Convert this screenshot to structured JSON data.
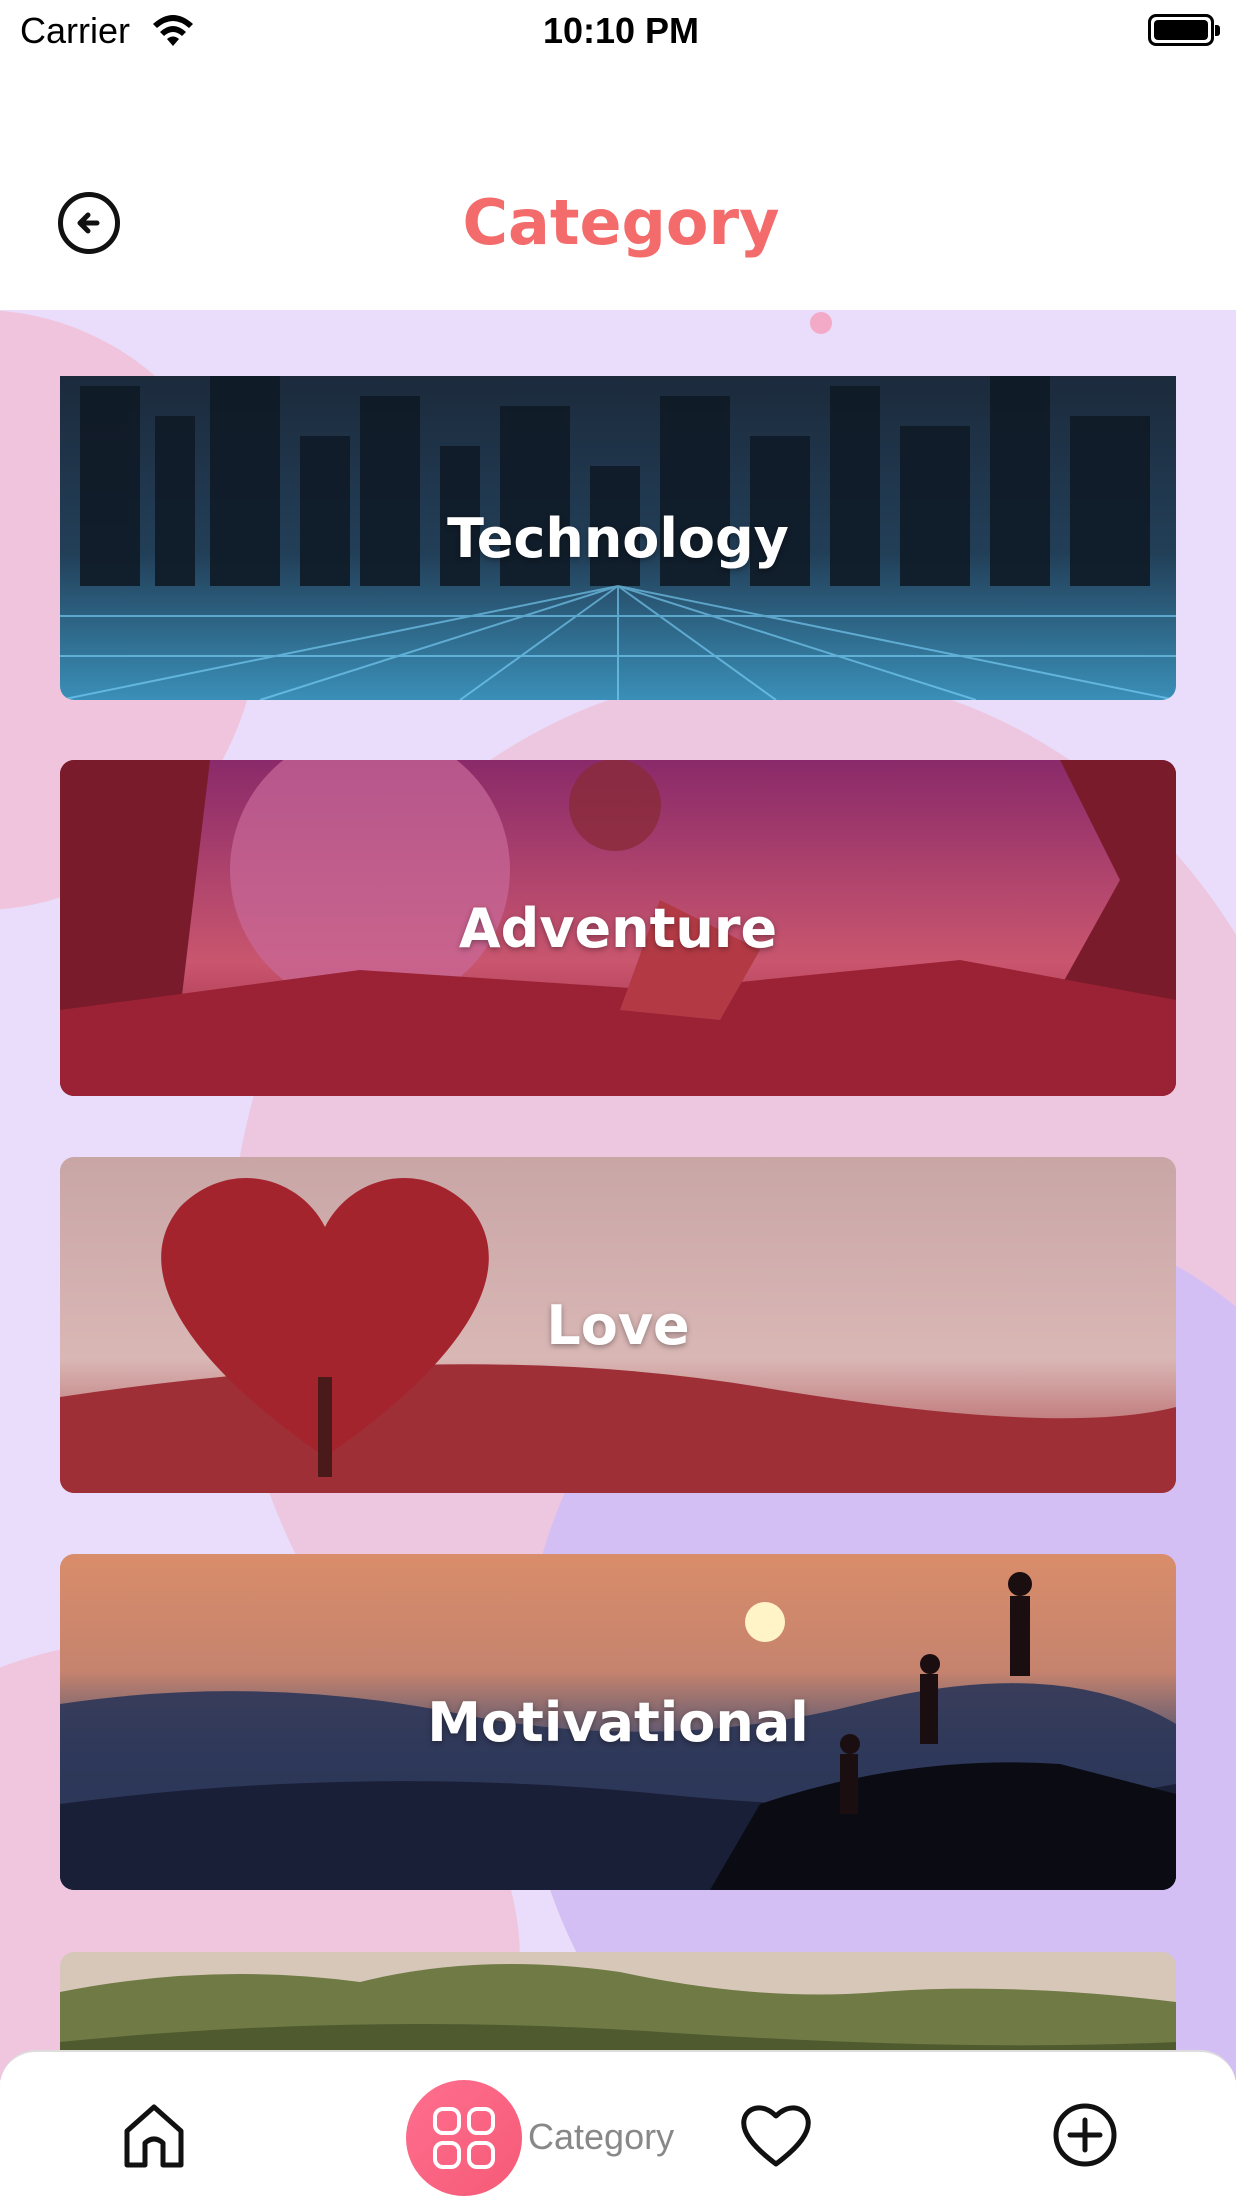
{
  "status_bar": {
    "carrier": "Carrier",
    "time": "10:10 PM"
  },
  "header": {
    "title": "Category",
    "back_icon": "arrow-left-circle-icon"
  },
  "categories": [
    {
      "label": "Technology"
    },
    {
      "label": "Adventure"
    },
    {
      "label": "Love"
    },
    {
      "label": "Motivational"
    },
    {
      "label": ""
    }
  ],
  "bottom_nav": {
    "home_icon": "home-icon",
    "category_icon": "grid-icon",
    "category_label": "Category",
    "favorites_icon": "heart-icon",
    "add_icon": "plus-circle-icon"
  },
  "colors": {
    "accent": "#f36b6b",
    "background": "#e9ddfb",
    "nav_active": "#f55a76"
  }
}
